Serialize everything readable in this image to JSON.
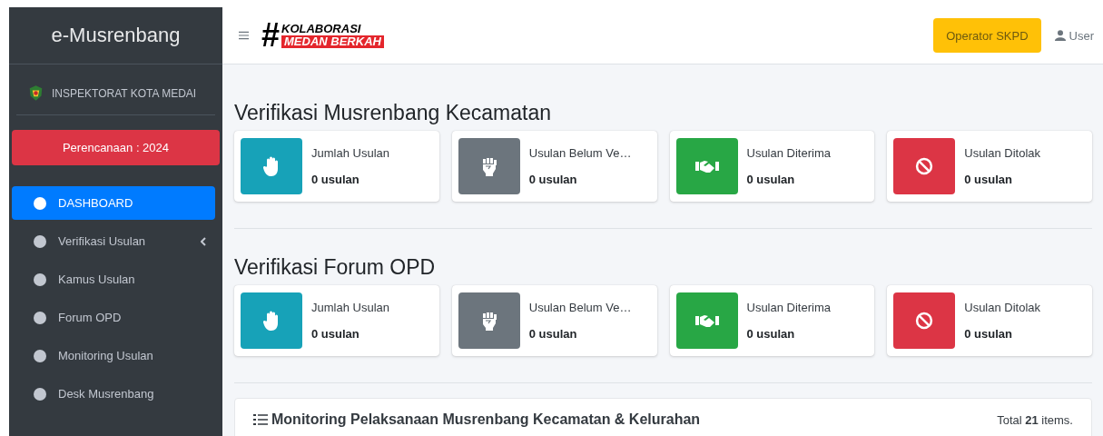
{
  "sidebar": {
    "brand": "e-Musrenbang",
    "user_panel": "INSPEKTORAT KOTA MEDAI",
    "year_button": "Perencanaan : 2024",
    "items": [
      {
        "label": "DASHBOARD",
        "selected": true,
        "has_submenu": false
      },
      {
        "label": "Verifikasi Usulan",
        "selected": false,
        "has_submenu": true
      },
      {
        "label": "Kamus Usulan",
        "selected": false,
        "has_submenu": false
      },
      {
        "label": "Forum OPD",
        "selected": false,
        "has_submenu": false
      },
      {
        "label": "Monitoring Usulan",
        "selected": false,
        "has_submenu": false
      },
      {
        "label": "Desk Musrenbang",
        "selected": false,
        "has_submenu": false
      }
    ]
  },
  "header": {
    "logo": {
      "hash": "#",
      "line_1": "KOLABORASI",
      "line_2": "MEDAN BERKAH"
    },
    "role_button": "Operator SKPD",
    "user": "User"
  },
  "sections": [
    {
      "title": "Verifikasi Musrenbang Kecamatan",
      "cards": [
        {
          "kind": "hand",
          "color": "#17a2b8",
          "label": "Jumlah Usulan",
          "value": "0 usulan"
        },
        {
          "kind": "fist",
          "color": "#6c757d",
          "label": "Usulan Belum Ve…",
          "value": "0 usulan"
        },
        {
          "kind": "handshake",
          "color": "#28a745",
          "label": "Usulan Diterima",
          "value": "0 usulan"
        },
        {
          "kind": "ban",
          "color": "#dc3545",
          "label": "Usulan Ditolak",
          "value": "0 usulan"
        }
      ]
    },
    {
      "title": "Verifikasi Forum OPD",
      "cards": [
        {
          "kind": "hand",
          "color": "#17a2b8",
          "label": "Jumlah Usulan",
          "value": "0 usulan"
        },
        {
          "kind": "fist",
          "color": "#6c757d",
          "label": "Usulan Belum Ve…",
          "value": "0 usulan"
        },
        {
          "kind": "handshake",
          "color": "#28a745",
          "label": "Usulan Diterima",
          "value": "0 usulan"
        },
        {
          "kind": "ban",
          "color": "#dc3545",
          "label": "Usulan Ditolak",
          "value": "0 usulan"
        }
      ]
    }
  ],
  "monitoring": {
    "title": "Monitoring Pelaksanaan Musrenbang Kecamatan & Kelurahan",
    "total": "Total **21** items."
  }
}
